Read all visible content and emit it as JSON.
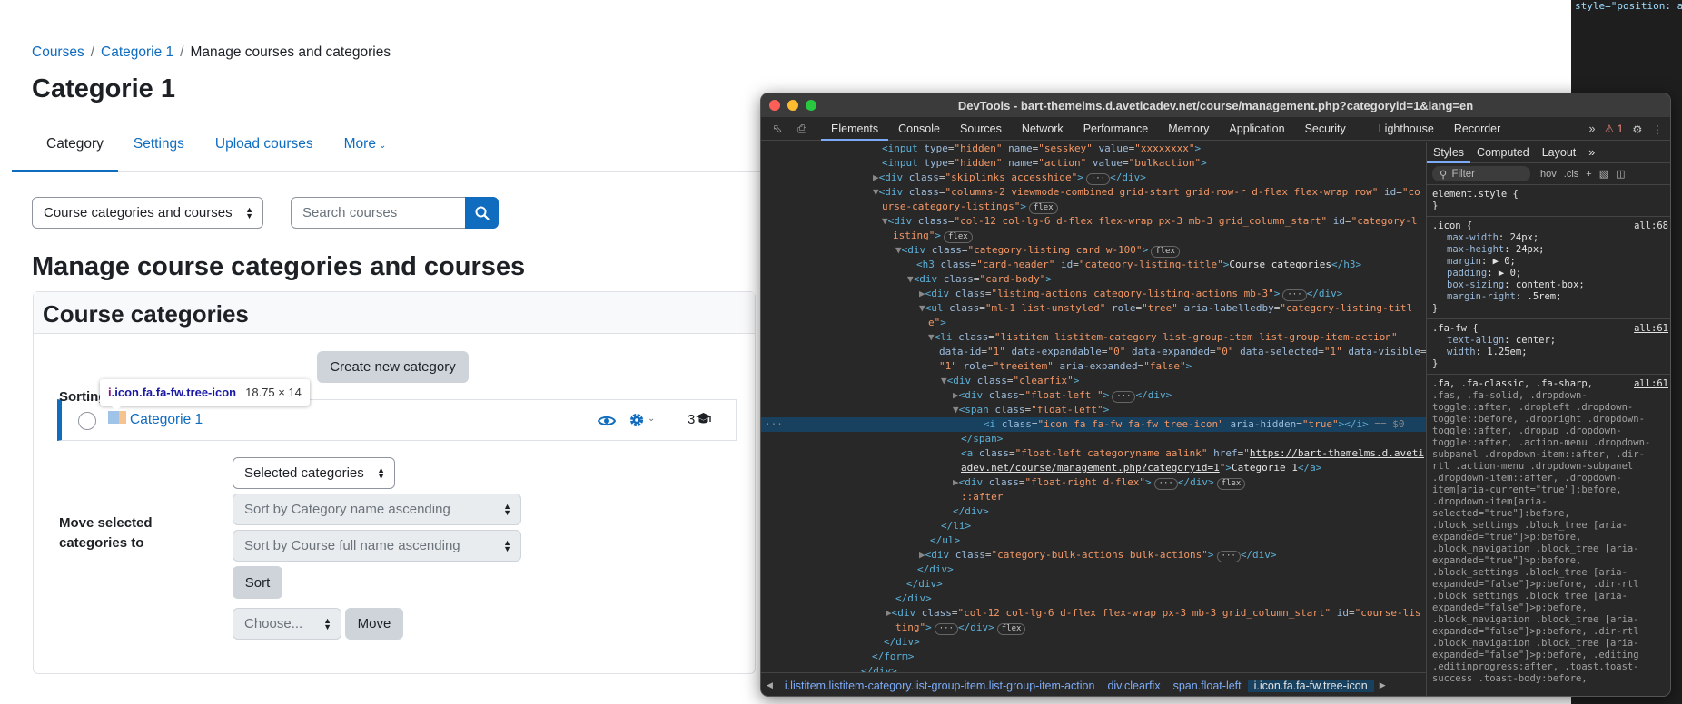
{
  "breadcrumb": {
    "items": [
      "Courses",
      "Categorie 1"
    ],
    "current": "Manage courses and categories",
    "separator": "/"
  },
  "page_title": "Categorie 1",
  "tabs": [
    {
      "label": "Category"
    },
    {
      "label": "Settings"
    },
    {
      "label": "Upload courses"
    },
    {
      "label": "More"
    }
  ],
  "view_select": {
    "value": "Course categories and courses"
  },
  "search": {
    "placeholder": "Search courses"
  },
  "section_title": "Manage course categories and courses",
  "card": {
    "header": "Course categories",
    "create_button": "Create new category",
    "category_name": "Categorie 1",
    "course_count": "3"
  },
  "tooltip": {
    "selector_tag": "i",
    "selector_classes": ".icon.fa.fa-fw.tree-icon",
    "dimensions": "18.75 × 14"
  },
  "sorting": {
    "label": "Sorting",
    "select1": "Selected categories",
    "select2": "Sort by Category name ascending",
    "select3": "Sort by Course full name ascending",
    "button": "Sort"
  },
  "move": {
    "label_line1": "Move selected",
    "label_line2": "categories to",
    "select": "Choose...",
    "button": "Move"
  },
  "darkstrip_text": "style=\"position: ab",
  "devtools": {
    "title": "DevTools - bart-themelms.d.aveticadev.net/course/management.php?categoryid=1&lang=en",
    "tabs": [
      "Elements",
      "Console",
      "Sources",
      "Network",
      "Performance",
      "Memory",
      "Application",
      "Security",
      "Lighthouse",
      "Recorder"
    ],
    "warning_count": "1",
    "styles_tabs": [
      "Styles",
      "Computed",
      "Layout"
    ],
    "filter_placeholder": "Filter",
    "hov": ":hov",
    "cls": ".cls",
    "crumbs": [
      "i.listitem.listitem-category.list-group-item.list-group-item-action",
      "div.clearfix",
      "span.float-left",
      "i.icon.fa.fa-fw.tree-icon"
    ],
    "rules": {
      "element_style": "element.style {",
      "icon_selector": ".icon {",
      "icon_src": "all:68",
      "icon_props": [
        [
          "max-width",
          "24px;"
        ],
        [
          "max-height",
          "24px;"
        ],
        [
          "margin",
          "▶ 0;"
        ],
        [
          "padding",
          "▶ 0;"
        ],
        [
          "box-sizing",
          "content-box;"
        ],
        [
          "margin-right",
          ".5rem;"
        ]
      ],
      "fafw_selector": ".fa-fw {",
      "fafw_src": "all:61",
      "fafw_props": [
        [
          "text-align",
          "center;"
        ],
        [
          "width",
          "1.25em;"
        ]
      ],
      "fa_src": "all:61",
      "fa_selector_lines": [
        ".fa, .fa-classic, .fa-sharp,",
        ".fas, .fa-solid, .dropdown-",
        "toggle::after, .dropleft .dropdown-",
        "toggle::before, .dropright .dropdown-",
        "toggle::after, .dropup .dropdown-",
        "toggle::after, .action-menu .dropdown-",
        "subpanel .dropdown-item::after, .dir-",
        "rtl .action-menu .dropdown-subpanel",
        ".dropdown-item::after, .dropdown-",
        "item[aria-current=\"true\"]:before,",
        ".dropdown-item[aria-",
        "selected=\"true\"]:before,",
        ".block_settings .block_tree [aria-",
        "expanded=\"true\"]>p:before,",
        ".block_navigation .block_tree [aria-",
        "expanded=\"true\"]>p:before,",
        ".block_settings .block_tree [aria-",
        "expanded=\"false\"]>p:before, .dir-rtl",
        ".block_settings .block_tree [aria-",
        "expanded=\"false\"]>p:before,",
        ".block_navigation .block_tree [aria-",
        "expanded=\"false\"]>p:before, .dir-rtl",
        ".block_navigation .block_tree [aria-",
        "expanded=\"false\"]>p:before, .editing",
        ".editinprogress:after, .toast.toast-",
        "success .toast-body:before,"
      ],
      "close": "}"
    }
  },
  "colors": {
    "link": "#0f6cbf",
    "primary": "#0f6cbf",
    "devtools_bg": "#282828"
  }
}
